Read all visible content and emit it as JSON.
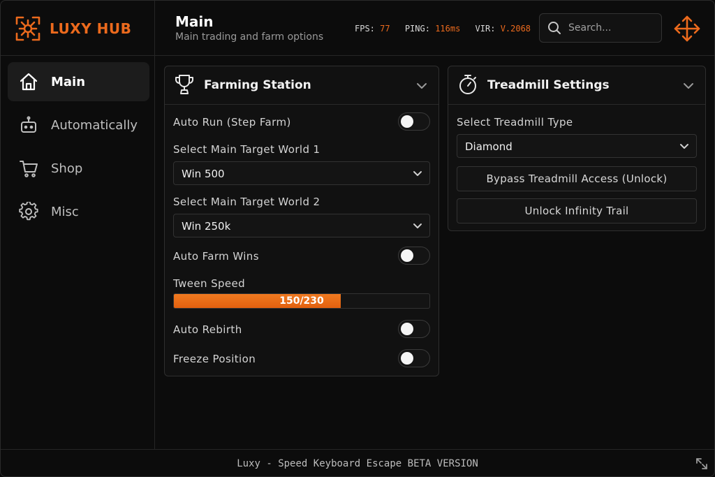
{
  "app": {
    "name": "LUXY HUB",
    "accent": "#ec6a1d"
  },
  "sidebar": {
    "items": [
      {
        "label": "Main",
        "icon": "home-icon",
        "active": true
      },
      {
        "label": "Automatically",
        "icon": "robot-icon",
        "active": false
      },
      {
        "label": "Shop",
        "icon": "cart-icon",
        "active": false
      },
      {
        "label": "Misc",
        "icon": "gear-icon",
        "active": false
      }
    ]
  },
  "header": {
    "title": "Main",
    "subtitle": "Main trading and farm options",
    "stats": {
      "fps_label": "FPS:",
      "fps_value": "77",
      "ping_label": "PING:",
      "ping_value": "116ms",
      "vir_label": "VIR:",
      "vir_value": "V.2068"
    },
    "search": {
      "placeholder": "Search..."
    },
    "move_icon": "move-icon"
  },
  "farming": {
    "title": "Farming Station",
    "icon": "trophy-icon",
    "auto_run": {
      "label": "Auto Run (Step Farm)",
      "enabled": false
    },
    "world1": {
      "label": "Select Main Target World 1",
      "value": "Win 500"
    },
    "world2": {
      "label": "Select Main Target World 2",
      "value": "Win 250k"
    },
    "auto_farm_wins": {
      "label": "Auto Farm Wins",
      "enabled": false
    },
    "tween_speed": {
      "label": "Tween Speed",
      "text": "150/230",
      "value": 150,
      "max": 230
    },
    "auto_rebirth": {
      "label": "Auto Rebirth",
      "enabled": false
    },
    "freeze_position": {
      "label": "Freeze Position",
      "enabled": false
    }
  },
  "treadmill": {
    "title": "Treadmill Settings",
    "icon": "stopwatch-icon",
    "type_label": "Select Treadmill Type",
    "type_value": "Diamond",
    "bypass_button": "Bypass Treadmill Access (Unlock)",
    "infinity_button": "Unlock Infinity Trail"
  },
  "footer": {
    "text": "Luxy - Speed Keyboard Escape BETA VERSION"
  }
}
